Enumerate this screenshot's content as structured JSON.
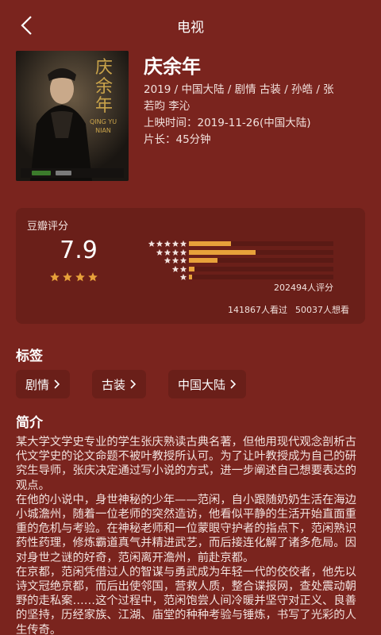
{
  "header": {
    "title": "电视",
    "back_icon": "chevron-left-icon"
  },
  "poster": {
    "title_chars": "庆余年",
    "subtitle": "QING YU NIAN"
  },
  "movie": {
    "title": "庆余年",
    "info_line1": "2019 / 中国大陆 / 剧情 古装 / 孙皓 / 张",
    "info_line2": "若昀 李沁",
    "release": "上映时间：2019-11-26(中国大陆)",
    "duration": "片长：45分钟"
  },
  "rating": {
    "label": "豆瓣评分",
    "score": "7.9",
    "stars_filled": 4,
    "count": "202494人评分",
    "distribution": [
      0.29,
      0.46,
      0.2,
      0.04,
      0.02
    ],
    "watched": "141867人看过",
    "want": "50037人想看",
    "accent": "#e8a13a"
  },
  "tags_section": {
    "title": "标签",
    "tags": [
      "剧情",
      "古装",
      "中国大陆"
    ]
  },
  "intro_section": {
    "title": "简介",
    "paragraphs": [
      "某大学文学史专业的学生张庆熟读古典名著，但他用现代观念剖析古代文学史的论文命题不被叶教授所认可。为了让叶教授成为自己的研究生导师，张庆决定通过写小说的方式，进一步阐述自己想要表达的观点。",
      "在他的小说中，身世神秘的少年——范闲，自小跟随奶奶生活在海边小城澹州，随着一位老师的突然造访，他看似平静的生活开始直面重重的危机与考验。在神秘老师和一位蒙眼守护者的指点下，范闲熟识药性药理，修炼霸道真气并精进武艺，而后接连化解了诸多危局。因对身世之谜的好奇，范闲离开澹州，前赴京都。",
      "在京都，范闲凭借过人的智谋与勇武成为年轻一代的佼佼者，他先以诗文冠绝京都，而后出使邻国，营救人质，整合谍报网，查处震动朝野的走私案……这个过程中，范闲饱尝人间冷暖并坚守对正义、良善的坚持，历经家族、江湖、庙堂的种种考验与锤炼，书写了光彩的人生传奇。"
    ]
  }
}
